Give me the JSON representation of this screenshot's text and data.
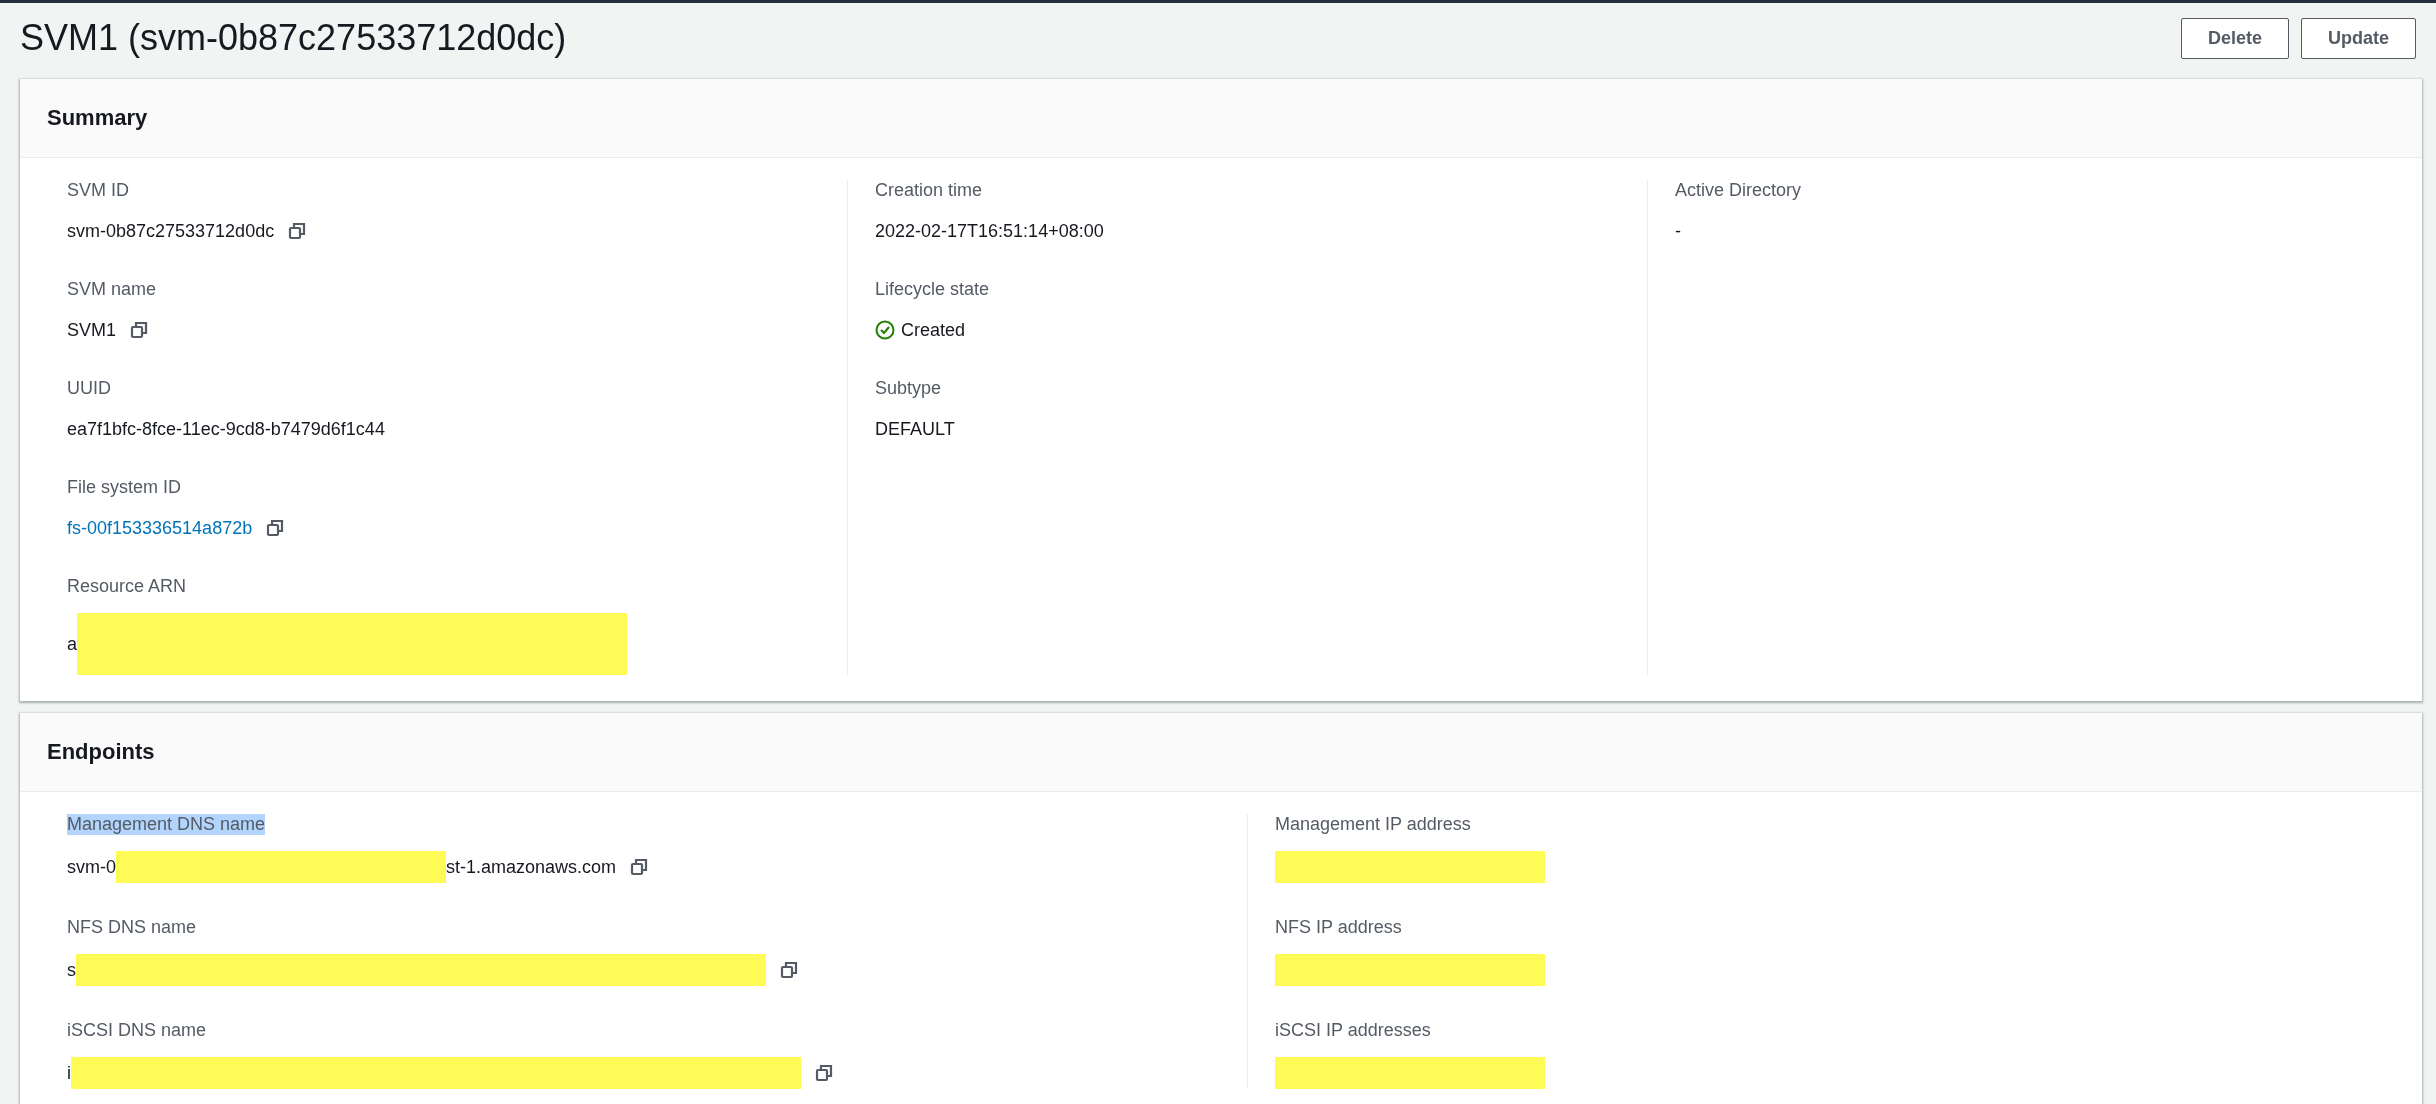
{
  "header": {
    "title": "SVM1 (svm-0b87c27533712d0dc)",
    "buttons": [
      "Delete",
      "Update"
    ]
  },
  "summary": {
    "title": "Summary",
    "columns": [
      [
        {
          "label": "SVM ID",
          "value": [
            {
              "kind": "text",
              "text": "svm-0b87c27533712d0dc"
            }
          ],
          "copy": true,
          "link": false
        },
        {
          "label": "SVM name",
          "value": [
            {
              "kind": "text",
              "text": "SVM1"
            }
          ],
          "copy": true,
          "link": false
        },
        {
          "label": "UUID",
          "value": [
            {
              "kind": "text",
              "text": "ea7f1bfc-8fce-11ec-9cd8-b7479d6f1c44"
            }
          ],
          "copy": false,
          "link": false
        },
        {
          "label": "File system ID",
          "value": [
            {
              "kind": "text",
              "text": "fs-00f153336514a872b"
            }
          ],
          "copy": true,
          "link": true
        },
        {
          "label": "Resource ARN",
          "value": [
            {
              "kind": "text",
              "text": "a"
            },
            {
              "kind": "redaction"
            }
          ],
          "copy": false,
          "link": false,
          "tall": true
        }
      ],
      [
        {
          "label": "Creation time",
          "value": [
            {
              "kind": "text",
              "text": "2022-02-17T16:51:14+08:00"
            }
          ],
          "copy": false,
          "link": false
        },
        {
          "label": "Lifecycle state",
          "value": [
            {
              "kind": "status",
              "text": "Created"
            }
          ],
          "copy": false
        },
        {
          "label": "Subtype",
          "value": [
            {
              "kind": "text",
              "text": "DEFAULT"
            }
          ],
          "copy": false,
          "link": false
        }
      ],
      [
        {
          "label": "Active Directory",
          "value": [
            {
              "kind": "text",
              "text": "-"
            }
          ],
          "copy": false,
          "link": false
        }
      ]
    ]
  },
  "endpoints": {
    "title": "Endpoints",
    "columns": [
      [
        {
          "label": "Management DNS name",
          "highlighted": true,
          "value": [
            {
              "kind": "text",
              "text": "svm-0"
            },
            {
              "kind": "redaction"
            },
            {
              "kind": "text",
              "text": "st-1.amazonaws.com"
            }
          ],
          "copy": true,
          "link": false
        },
        {
          "label": "NFS DNS name",
          "highlighted": false,
          "value": [
            {
              "kind": "text",
              "text": "s"
            },
            {
              "kind": "redaction",
              "wide": true
            }
          ],
          "copy": true,
          "link": false
        },
        {
          "label": "iSCSI DNS name",
          "highlighted": false,
          "value": [
            {
              "kind": "text",
              "text": "i"
            },
            {
              "kind": "redaction",
              "wider": true
            }
          ],
          "copy": true,
          "link": false
        }
      ],
      [
        {
          "label": "Management IP address",
          "highlighted": false,
          "value": [
            {
              "kind": "redaction",
              "ip": true
            }
          ],
          "copy": false
        },
        {
          "label": "NFS IP address",
          "highlighted": false,
          "value": [
            {
              "kind": "redaction",
              "ip": true
            }
          ],
          "copy": false
        },
        {
          "label": "iSCSI IP addresses",
          "highlighted": false,
          "value": [
            {
              "kind": "redaction",
              "ip": true
            }
          ],
          "copy": false
        }
      ]
    ]
  }
}
